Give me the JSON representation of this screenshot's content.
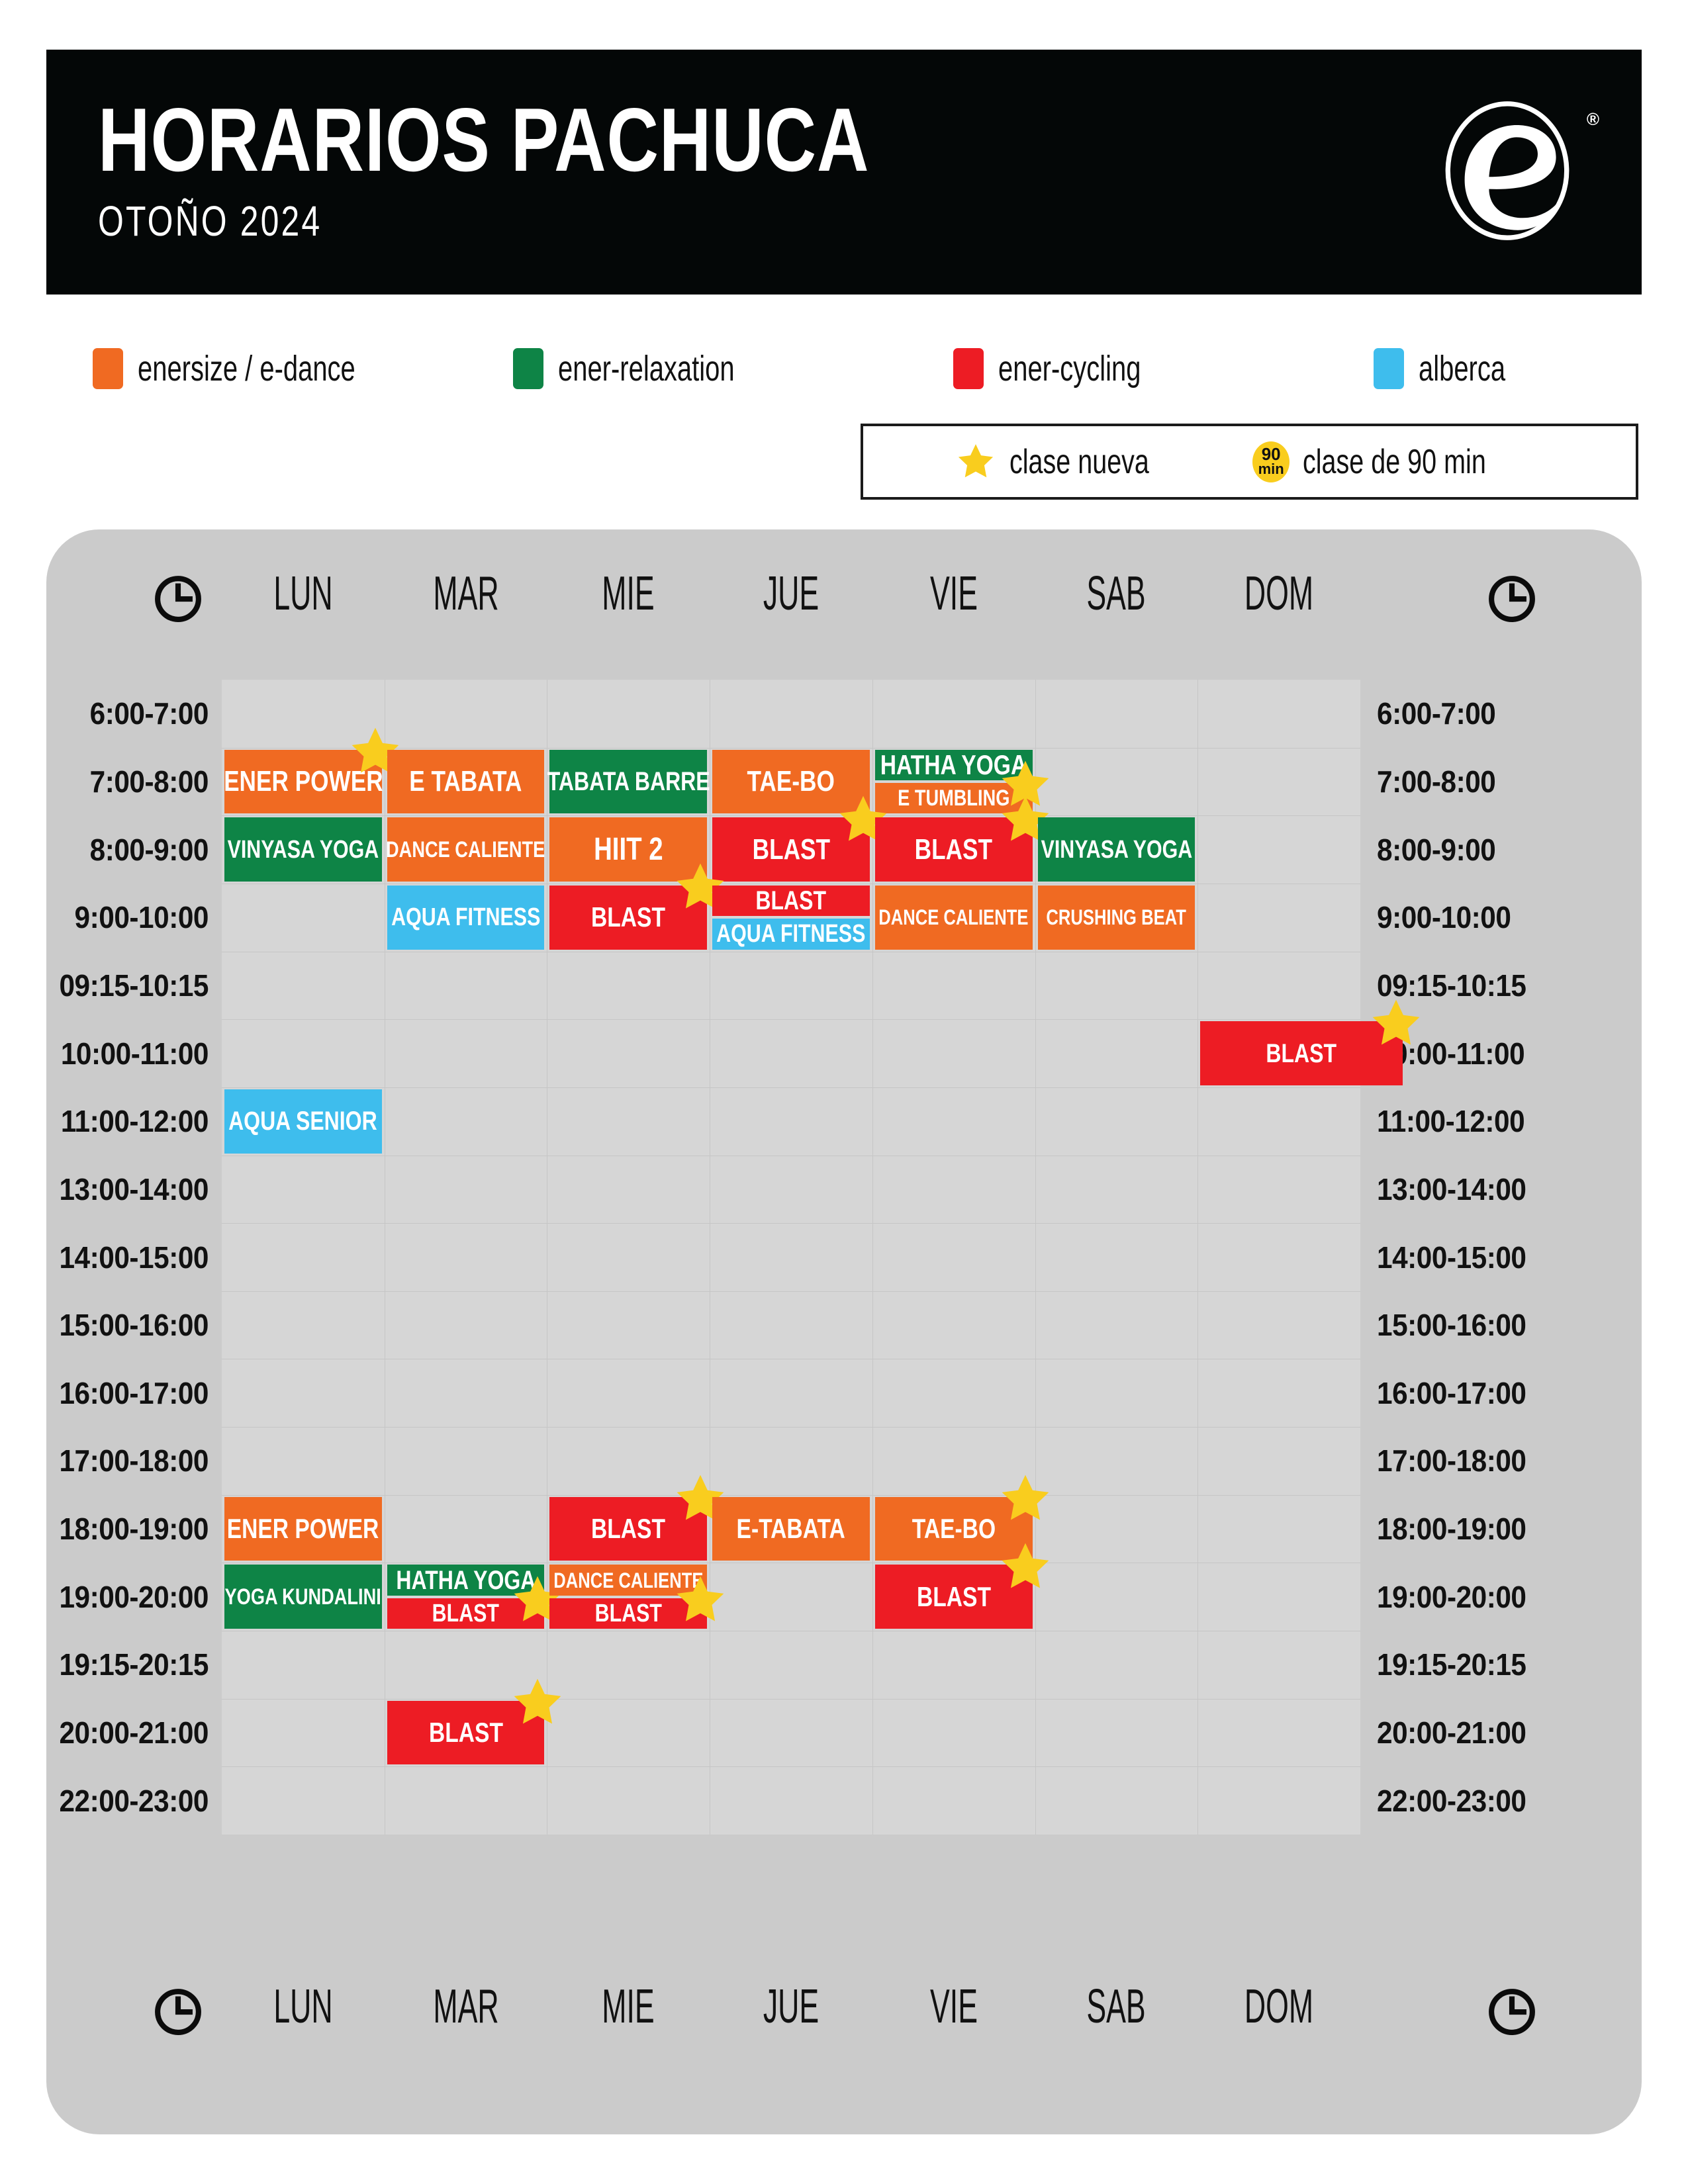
{
  "header": {
    "title": "HORARIOS PACHUCA",
    "subtitle": "OTOÑO  2024",
    "logo_name": "ener-e-logo",
    "registered_mark": "®"
  },
  "legend": {
    "categories": [
      {
        "label": "enersize / e-dance",
        "color": "#F06A22"
      },
      {
        "label": "ener-relaxation",
        "color": "#0E8446"
      },
      {
        "label": "ener-cycling",
        "color": "#ED1C24"
      },
      {
        "label": "alberca",
        "color": "#3EBDED"
      }
    ],
    "markers": [
      {
        "label": "clase nueva",
        "icon": "star-icon",
        "color": "#F9CD1E"
      },
      {
        "label": "clase de 90 min",
        "icon": "90min-badge-icon",
        "badge_top": "90",
        "badge_bottom": "min",
        "color": "#F9CD1E"
      }
    ]
  },
  "schedule": {
    "days": [
      "LUN",
      "MAR",
      "MIE",
      "JUE",
      "VIE",
      "SAB",
      "DOM"
    ],
    "times": [
      "6:00-7:00",
      "7:00-8:00",
      "8:00-9:00",
      "9:00-10:00",
      "09:15-10:15",
      "10:00-11:00",
      "11:00-12:00",
      "13:00-14:00",
      "14:00-15:00",
      "15:00-16:00",
      "16:00-17:00",
      "17:00-18:00",
      "18:00-19:00",
      "19:00-20:00",
      "19:15-20:15",
      "20:00-21:00",
      "22:00-23:00"
    ],
    "clock_icon": "clock-icon",
    "classes": [
      {
        "name": "ENER POWER",
        "day": "LUN",
        "time": "7:00-8:00",
        "color": "#F06A22",
        "new": true
      },
      {
        "name": "E TABATA",
        "day": "MAR",
        "time": "7:00-8:00",
        "color": "#F06A22",
        "new": false
      },
      {
        "name": "TABATA BARRE",
        "day": "MIE",
        "time": "7:00-8:00",
        "color": "#0E8446",
        "new": false
      },
      {
        "name": "TAE-BO",
        "day": "JUE",
        "time": "7:00-8:00",
        "color": "#F06A22",
        "new": false
      },
      {
        "name": "HATHA YOGA",
        "day": "VIE",
        "time": "7:00-8:00",
        "color": "#0E8446",
        "new": false
      },
      {
        "name": "E TUMBLING",
        "day": "VIE",
        "time": "7:00-8:00",
        "color": "#F06A22",
        "new": true
      },
      {
        "name": "VINYASA YOGA",
        "day": "LUN",
        "time": "8:00-9:00",
        "color": "#0E8446",
        "new": false
      },
      {
        "name": "DANCE CALIENTE",
        "day": "MAR",
        "time": "8:00-9:00",
        "color": "#F06A22",
        "new": false
      },
      {
        "name": "HIIT 2",
        "day": "MIE",
        "time": "8:00-9:00",
        "color": "#F06A22",
        "new": false
      },
      {
        "name": "BLAST",
        "day": "JUE",
        "time": "8:00-9:00",
        "color": "#ED1C24",
        "new": true
      },
      {
        "name": "BLAST",
        "day": "VIE",
        "time": "8:00-9:00",
        "color": "#ED1C24",
        "new": true
      },
      {
        "name": "VINYASA YOGA",
        "day": "SAB",
        "time": "8:00-9:00",
        "color": "#0E8446",
        "new": false
      },
      {
        "name": "AQUA FITNESS",
        "day": "MAR",
        "time": "9:00-10:00",
        "color": "#3EBDED",
        "new": false
      },
      {
        "name": "BLAST",
        "day": "MIE",
        "time": "9:00-10:00",
        "color": "#ED1C24",
        "new": true
      },
      {
        "name": "BLAST",
        "day": "JUE",
        "time": "9:00-10:00",
        "color": "#ED1C24",
        "new": false
      },
      {
        "name": "AQUA FITNESS",
        "day": "JUE",
        "time": "9:00-10:00",
        "color": "#3EBDED",
        "new": false
      },
      {
        "name": "DANCE CALIENTE",
        "day": "VIE",
        "time": "9:00-10:00",
        "color": "#F06A22",
        "new": false
      },
      {
        "name": "CRUSHING BEAT",
        "day": "SAB",
        "time": "9:00-10:00",
        "color": "#F06A22",
        "new": false
      },
      {
        "name": "BLAST",
        "day": "DOM",
        "time": "10:00-11:00",
        "color": "#ED1C24",
        "new": true
      },
      {
        "name": "AQUA SENIOR",
        "day": "LUN",
        "time": "11:00-12:00",
        "color": "#3EBDED",
        "new": false
      },
      {
        "name": "ENER POWER",
        "day": "LUN",
        "time": "18:00-19:00",
        "color": "#F06A22",
        "new": false
      },
      {
        "name": "BLAST",
        "day": "MIE",
        "time": "18:00-19:00",
        "color": "#ED1C24",
        "new": true
      },
      {
        "name": "E-TABATA",
        "day": "JUE",
        "time": "18:00-19:00",
        "color": "#F06A22",
        "new": false
      },
      {
        "name": "TAE-BO",
        "day": "VIE",
        "time": "18:00-19:00",
        "color": "#F06A22",
        "new": true
      },
      {
        "name": "YOGA KUNDALINI",
        "day": "LUN",
        "time": "19:00-20:00",
        "color": "#0E8446",
        "new": false
      },
      {
        "name": "HATHA YOGA",
        "day": "MAR",
        "time": "19:00-20:00",
        "color": "#0E8446",
        "new": false
      },
      {
        "name": "BLAST",
        "day": "MAR",
        "time": "19:00-20:00",
        "color": "#ED1C24",
        "new": true
      },
      {
        "name": "DANCE CALIENTE",
        "day": "MIE",
        "time": "19:00-20:00",
        "color": "#F06A22",
        "new": false
      },
      {
        "name": "BLAST",
        "day": "MIE",
        "time": "19:00-20:00",
        "color": "#ED1C24",
        "new": true
      },
      {
        "name": "BLAST",
        "day": "VIE",
        "time": "19:00-20:00",
        "color": "#ED1C24",
        "new": true
      },
      {
        "name": "BLAST",
        "day": "MAR",
        "time": "20:00-21:00",
        "color": "#ED1C24",
        "new": true
      }
    ]
  }
}
